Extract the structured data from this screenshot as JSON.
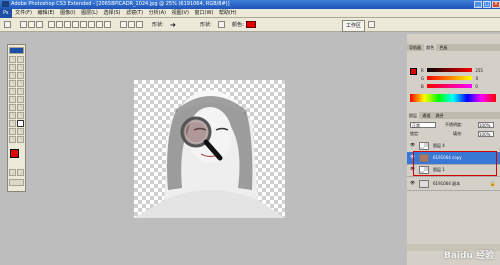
{
  "app": {
    "title": "Adobe Photoshop CS3 Extended - [20658PICADR_1024.jpg @ 25% (6191064, RGB/8#)]",
    "logo_label": "Ps"
  },
  "menu": [
    "文件(F)",
    "编辑(E)",
    "图像(I)",
    "图层(L)",
    "选择(S)",
    "滤镜(T)",
    "分析(A)",
    "视图(V)",
    "窗口(W)",
    "帮助(H)"
  ],
  "options": {
    "contiguous_label": "形状:",
    "mode_label": "颜色:",
    "workspace_label": "工作区",
    "accent": "#e00000"
  },
  "panels": {
    "color_tabs": [
      "导航器",
      "颜色",
      "色板"
    ],
    "color_rows": [
      {
        "label": "R",
        "value": "255"
      },
      {
        "label": "G",
        "value": "0"
      },
      {
        "label": "B",
        "value": "0"
      }
    ],
    "layers_tabs": [
      "图层",
      "通道",
      "路径"
    ],
    "blend_mode": "正常",
    "opacity_label": "不透明度:",
    "opacity_value": "100%",
    "lock_label": "锁定:",
    "fill_label": "填充:",
    "fill_value": "100%",
    "layers": [
      {
        "name": "图层 4",
        "selected": false
      },
      {
        "name": "6191064 copy",
        "selected": true
      },
      {
        "name": "图层 1",
        "selected": false
      },
      {
        "name": "6191064 副本",
        "selected": false
      }
    ]
  },
  "colors": {
    "foreground": "#e00000",
    "background": "#ffffff",
    "selection": "#3a78d6",
    "highlight_ring": "#d40000"
  },
  "watermark": "Baidu 经验"
}
